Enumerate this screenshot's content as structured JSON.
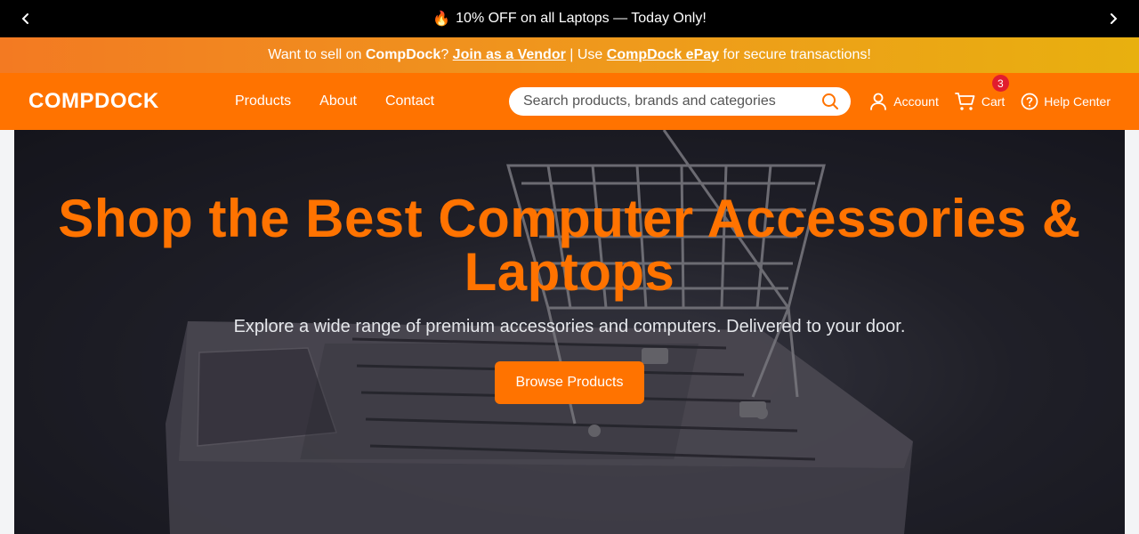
{
  "promo": {
    "text": "10% OFF on all Laptops — Today Only!",
    "flame_icon": "🔥"
  },
  "vendor_bar": {
    "prefix": "Want to sell on ",
    "brand": "CompDock",
    "q": "? ",
    "join_link": "Join as a Vendor",
    "mid": " | Use ",
    "epay_link": "CompDock ePay",
    "suffix": " for secure transactions!"
  },
  "header": {
    "logo": "COMPDOCK",
    "nav": [
      "Products",
      "About",
      "Contact"
    ],
    "search_placeholder": "Search products, brands and categories",
    "account_label": "Account",
    "cart_label": "Cart",
    "cart_count": "3",
    "help_label": "Help Center"
  },
  "hero": {
    "title": "Shop the Best Computer Accessories & Laptops",
    "subtitle": "Explore a wide range of premium accessories and computers. Delivered to your door.",
    "cta": "Browse Products"
  },
  "colors": {
    "accent": "#ff7300",
    "badge": "#e11d2e",
    "promo_bg": "#000000"
  }
}
